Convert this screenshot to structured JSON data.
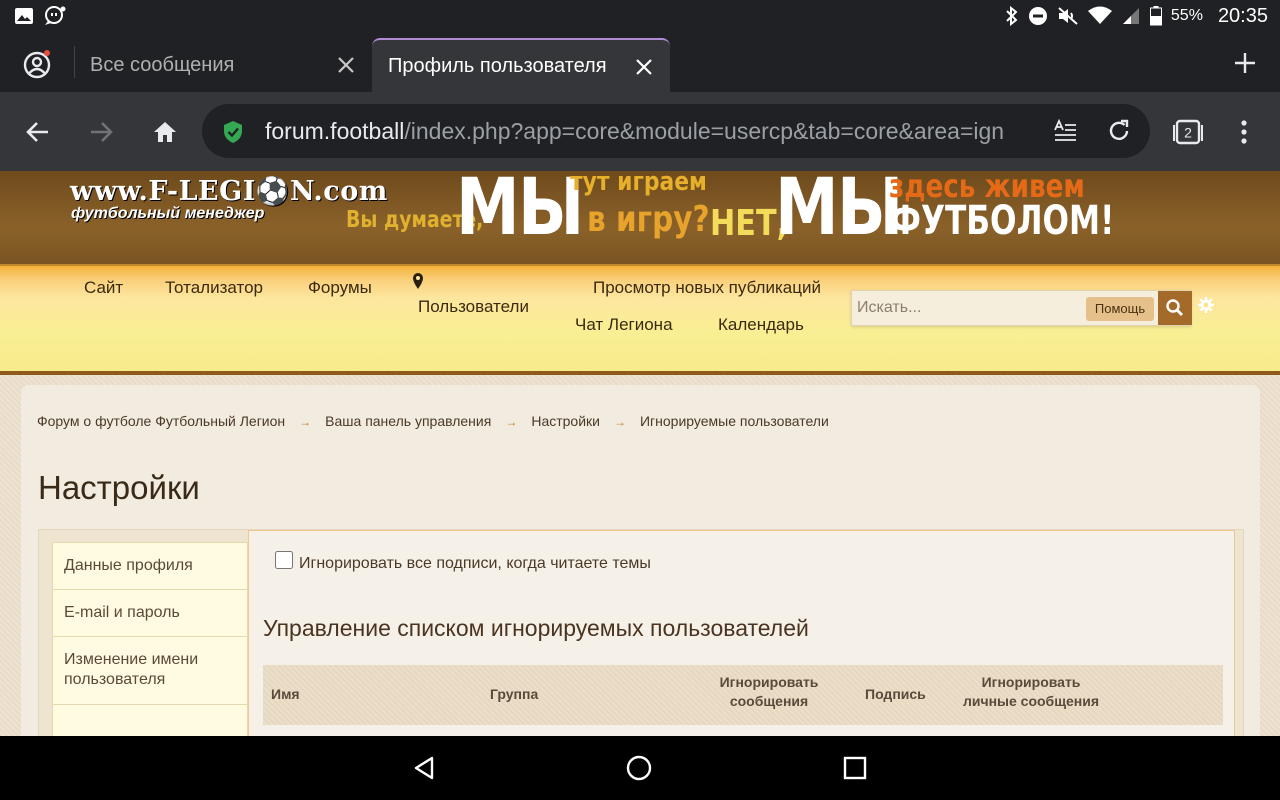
{
  "status_bar": {
    "battery_percent": "55%",
    "time": "20:35",
    "icons": [
      "image-icon",
      "quote-bubble-icon",
      "bluetooth-icon",
      "do-not-disturb-icon",
      "mute-icon",
      "wifi-icon",
      "signal-icon",
      "battery-icon"
    ]
  },
  "browser": {
    "tabs": [
      {
        "title": "Все сообщения",
        "active": false
      },
      {
        "title": "Профиль пользователя",
        "active": true
      }
    ],
    "url_host": "forum.football",
    "url_path": "/index.php?app=core&module=usercp&tab=core&area=ign",
    "tab_count": "2",
    "colors": {
      "chrome_dark": "#202124",
      "toolbar": "#35363a",
      "active_tab_accent": "#b08bd6",
      "secure": "#34a853"
    }
  },
  "banner": {
    "site_url": "www.F-LEGI⚽N.com",
    "site_subtitle": "футбольный менеджер",
    "slogan": {
      "part1": "Вы думаете,",
      "part2": "МЫ",
      "part3": "тут играем",
      "part4": "в игру?",
      "part5": "НЕТ,",
      "part6": "МЫ",
      "part7": "здесь живем",
      "part8": "ФУТБОЛОМ!"
    }
  },
  "nav": {
    "items": [
      "Сайт",
      "Тотализатор",
      "Форумы",
      "Пользователи",
      "Просмотр новых публикаций",
      "Чат Легиона",
      "Календарь"
    ],
    "search_placeholder": "Искать...",
    "help_label": "Помощь"
  },
  "breadcrumb": [
    "Форум о футболе Футбольный Легион",
    "Ваша панель управления",
    "Настройки",
    "Игнорируемые пользователи"
  ],
  "breadcrumb_separator": "→",
  "page_title": "Настройки",
  "side_menu": [
    "Данные профиля",
    "E-mail и пароль",
    "Изменение имени пользователя"
  ],
  "content": {
    "ignore_signatures_label": "Игнорировать все подписи, когда читаете темы",
    "ignore_signatures_checked": false,
    "section_title": "Управление списком игнорируемых пользователей",
    "table_headers": {
      "name": "Имя",
      "group": "Группа",
      "ignore_posts_1": "Игнорировать",
      "ignore_posts_2": "сообщения",
      "signature": "Подпись",
      "ignore_pm_1": "Игнорировать",
      "ignore_pm_2": "личные сообщения"
    }
  }
}
